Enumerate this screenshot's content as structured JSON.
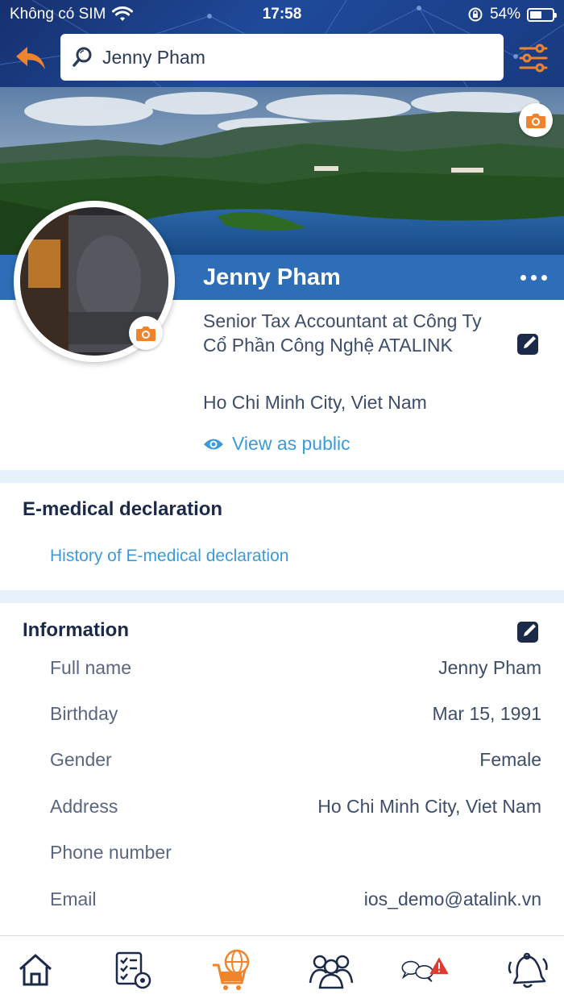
{
  "status_bar": {
    "carrier": "Không có SIM",
    "time": "17:58",
    "battery": "54%",
    "battery_level": 0.54
  },
  "search": {
    "value": "Jenny Pham"
  },
  "profile": {
    "name": "Jenny Pham",
    "job_title": "Senior Tax Accountant  at Công Ty Cổ Phần Công Nghệ ATALINK",
    "location": "Ho Chi Minh City, Viet Nam",
    "view_public_label": "View as public"
  },
  "medical": {
    "title": "E-medical declaration",
    "link": "History of E-medical declaration"
  },
  "information": {
    "title": "Information",
    "rows": [
      {
        "label": "Full name",
        "value": "Jenny Pham"
      },
      {
        "label": "Birthday",
        "value": "Mar 15, 1991"
      },
      {
        "label": "Gender",
        "value": "Female"
      },
      {
        "label": "Address",
        "value": "Ho Chi Minh City, Viet Nam"
      },
      {
        "label": "Phone number",
        "value": ""
      },
      {
        "label": "Email",
        "value": "ios_demo@atalink.vn"
      }
    ]
  },
  "tabbar": {
    "items": [
      {
        "icon": "home-icon"
      },
      {
        "icon": "tasks-settings-icon"
      },
      {
        "icon": "global-cart-icon"
      },
      {
        "icon": "people-icon"
      },
      {
        "icon": "chat-alert-icon"
      },
      {
        "icon": "bell-icon"
      }
    ]
  },
  "colors": {
    "header": "#1f4a9a",
    "name_band": "#2e6db7",
    "accent_orange": "#f0842c",
    "link_blue": "#3d9ad9",
    "section_divider": "#e6f1fb",
    "alert_red": "#e03a2e"
  }
}
